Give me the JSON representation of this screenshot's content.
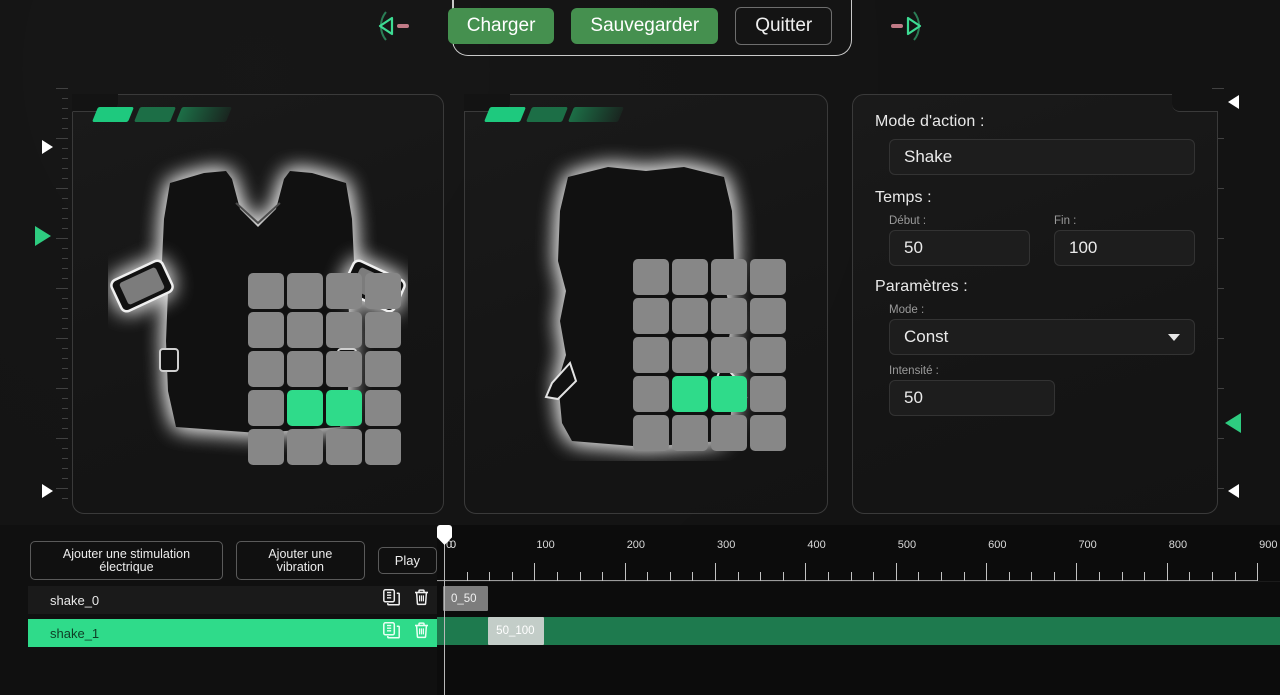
{
  "header": {
    "buttons": [
      {
        "label": "Charger",
        "style": "green"
      },
      {
        "label": "Sauvegarder",
        "style": "green"
      },
      {
        "label": "Quitter",
        "style": "outline"
      }
    ],
    "left_arrow_icon": "chevron-left-icon",
    "right_arrow_icon": "chevron-right-icon",
    "accent_color": "#45904f"
  },
  "side_rulers": {
    "left": {
      "markers": [
        "triangle-right-white",
        "triangle-right-green",
        "triangle-right-white"
      ]
    },
    "right": {
      "markers": [
        "triangle-left-white",
        "triangle-left-green",
        "triangle-left-white"
      ]
    }
  },
  "panels": {
    "vest_front": {
      "name": "Vest front view",
      "status_bars": 3,
      "grid": {
        "rows": 5,
        "cols": 4,
        "active_cells": [
          [
            3,
            1
          ],
          [
            3,
            2
          ]
        ],
        "active_color": "#2fdb8a",
        "inactive_color": "#878787"
      }
    },
    "vest_back": {
      "name": "Vest back view",
      "status_bars": 3,
      "grid": {
        "rows": 5,
        "cols": 4,
        "active_cells": [
          [
            3,
            1
          ],
          [
            3,
            2
          ]
        ],
        "active_color": "#2fdb8a",
        "inactive_color": "#878787"
      }
    }
  },
  "inspector": {
    "action_mode_label": "Mode d'action :",
    "action_mode_value": "Shake",
    "time_label": "Temps :",
    "start_label": "Début :",
    "start_value": "50",
    "end_label": "Fin :",
    "end_value": "100",
    "params_label": "Paramètres :",
    "mode_label": "Mode :",
    "mode_value": "Const",
    "mode_caret_icon": "chevron-down-icon",
    "intensity_label": "Intensité :",
    "intensity_value": "50"
  },
  "bottom": {
    "toolbar": {
      "add_electric_label": "Ajouter une stimulation électrique",
      "add_vibration_label": "Ajouter une vibration",
      "play_label": "Play"
    },
    "tracks": [
      {
        "name": "shake_0",
        "selected": false,
        "duplicate_icon": "copy-icon",
        "delete_icon": "trash-icon",
        "clip": {
          "label": "0_50",
          "start": 0,
          "end": 50,
          "style": "grey"
        }
      },
      {
        "name": "shake_1",
        "selected": true,
        "duplicate_icon": "copy-icon",
        "delete_icon": "trash-icon",
        "clip": {
          "label": "50_100",
          "start": 50,
          "end": 100,
          "style": "light"
        }
      }
    ],
    "playhead": {
      "position_label": "0",
      "value": 0
    },
    "ruler": {
      "labels": [
        "0",
        "100",
        "200",
        "300",
        "400",
        "500",
        "600",
        "700",
        "800",
        "900"
      ],
      "values": [
        0,
        100,
        200,
        300,
        400,
        500,
        600,
        700,
        800,
        900
      ],
      "minor_step": 25
    }
  },
  "colors": {
    "background": "#131313",
    "panel": "#1a1a1a",
    "accent_green": "#2fdb8a",
    "button_green": "#45904f",
    "track_green": "#1e7a4e"
  }
}
